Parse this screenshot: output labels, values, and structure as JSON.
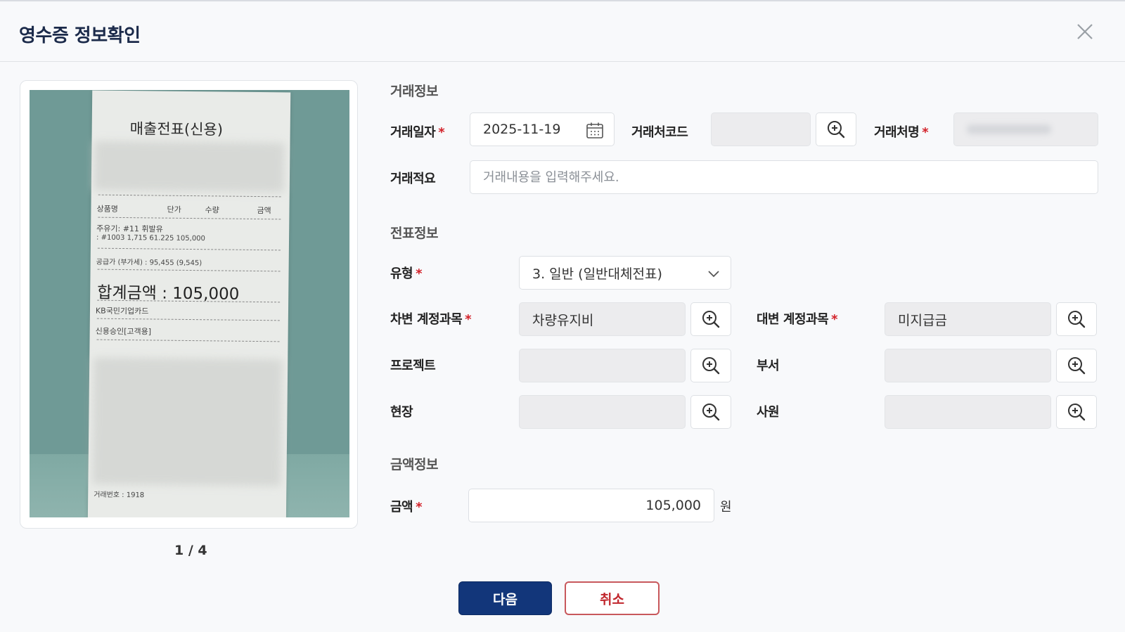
{
  "header": {
    "title": "영수증 정보확인"
  },
  "receipt_image": {
    "title": "매출전표(신용)",
    "columns": [
      "상품명",
      "단가",
      "수량",
      "금액"
    ],
    "item_line1": "주유기: #11   휘발유",
    "item_line2": ": #1003   1,715   61.225      105,000",
    "supply_line": "공급가 (부가세) : 95,455 (9,545)",
    "total": "합계금액  :  105,000",
    "card": "KB국민기업카드",
    "approval": "신용승인[고객용]",
    "trans_no": "거래번호 : 1918"
  },
  "pager": {
    "text": "1 / 4"
  },
  "sections": {
    "transaction": "거래정보",
    "voucher": "전표정보",
    "amount": "금액정보"
  },
  "transaction": {
    "date_label": "거래일자",
    "date_value": "2025-11-19",
    "vendor_code_label": "거래처코드",
    "vendor_name_label": "거래처명",
    "memo_label": "거래적요",
    "memo_placeholder": "거래내용을 입력해주세요."
  },
  "voucher": {
    "type_label": "유형",
    "type_value": "3. 일반 (일반대체전표)",
    "debit_label": "차변 계정과목",
    "debit_value": "차량유지비",
    "credit_label": "대변 계정과목",
    "credit_value": "미지급금",
    "project_label": "프로젝트",
    "dept_label": "부서",
    "site_label": "현장",
    "employee_label": "사원"
  },
  "amount": {
    "label": "금액",
    "value": "105,000",
    "unit": "원"
  },
  "buttons": {
    "next": "다음",
    "cancel": "취소"
  },
  "required_mark": "*",
  "colors": {
    "primary": "#12367a",
    "required": "#d3222a",
    "cancel": "#c1272d"
  }
}
